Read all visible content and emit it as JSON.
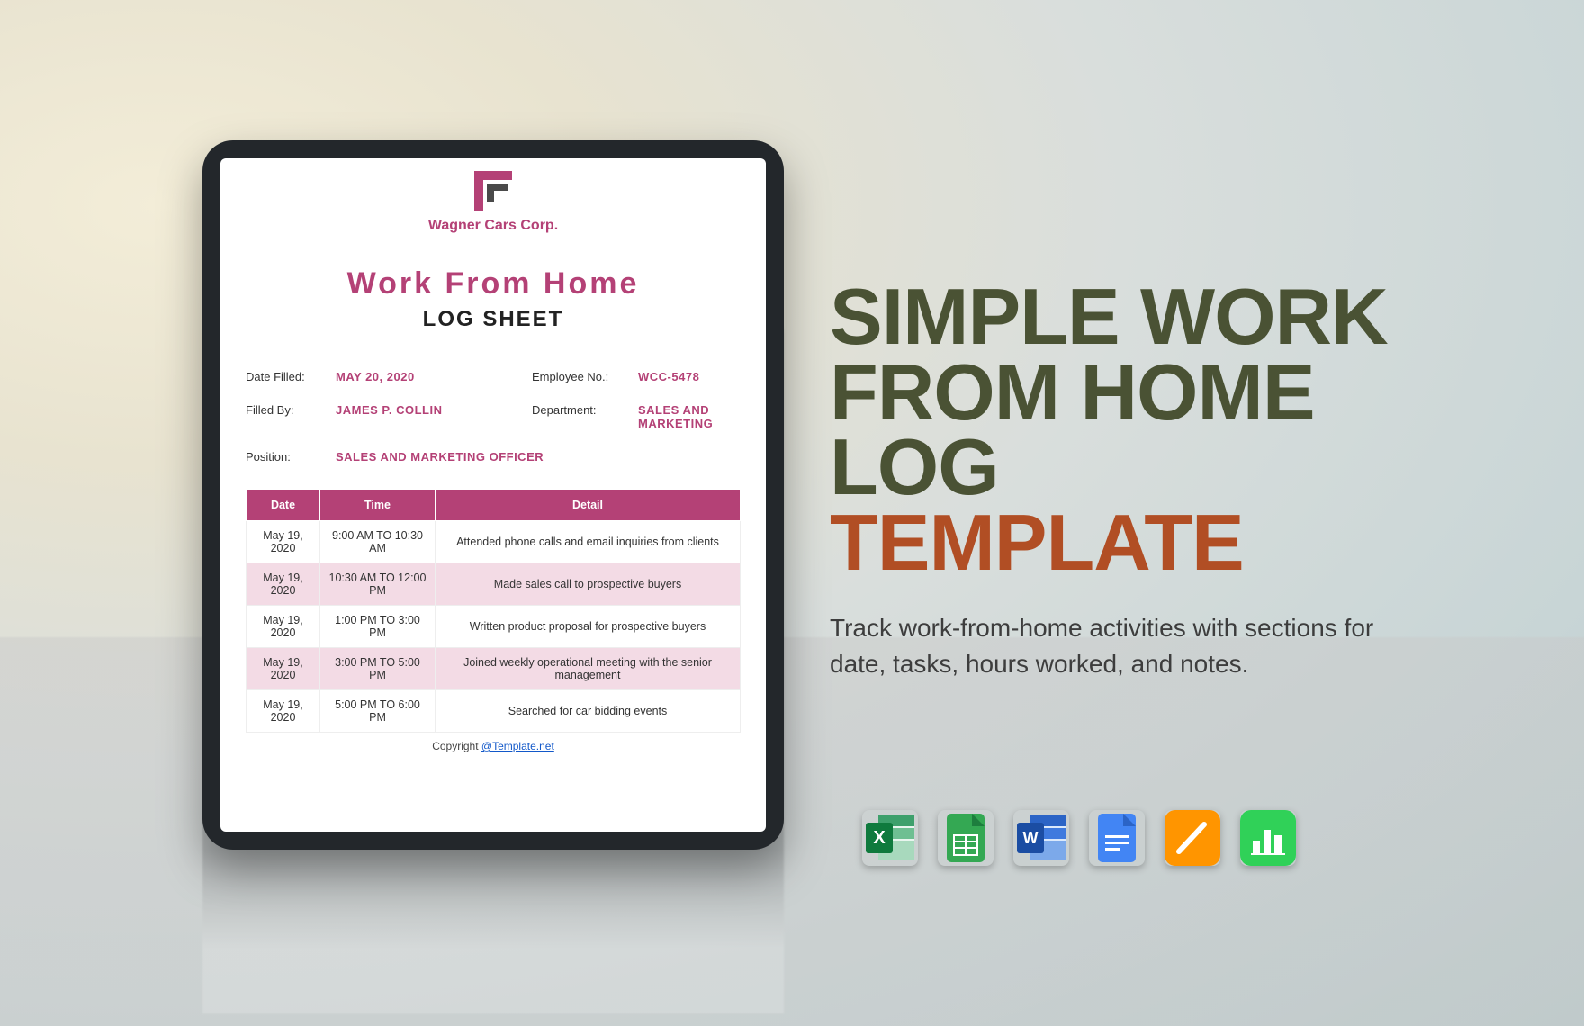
{
  "side": {
    "heading_main": "SIMPLE WORK FROM HOME LOG",
    "heading_accent": "TEMPLATE",
    "description": "Track work-from-home activities with sections for date, tasks, hours worked, and notes."
  },
  "apps": [
    {
      "name": "excel-icon"
    },
    {
      "name": "google-sheets-icon"
    },
    {
      "name": "word-icon"
    },
    {
      "name": "google-docs-icon"
    },
    {
      "name": "apple-pages-icon"
    },
    {
      "name": "apple-numbers-icon"
    }
  ],
  "doc": {
    "company": "Wagner Cars Corp.",
    "title_top": "Work From Home",
    "title_bottom": "LOG SHEET",
    "meta": {
      "date_filled_label": "Date Filled:",
      "date_filled": "MAY 20, 2020",
      "employee_no_label": "Employee No.:",
      "employee_no": "WCC-5478",
      "filled_by_label": "Filled By:",
      "filled_by": "JAMES P. COLLIN",
      "department_label": "Department:",
      "department": "SALES AND MARKETING",
      "position_label": "Position:",
      "position": "SALES AND MARKETING OFFICER"
    },
    "columns": [
      "Date",
      "Time",
      "Detail"
    ],
    "rows": [
      {
        "date": "May 19, 2020",
        "time": "9:00 AM TO 10:30 AM",
        "detail": "Attended phone calls and email inquiries from clients"
      },
      {
        "date": "May 19, 2020",
        "time": "10:30 AM TO 12:00 PM",
        "detail": "Made sales call to prospective buyers"
      },
      {
        "date": "May 19, 2020",
        "time": "1:00 PM TO 3:00 PM",
        "detail": "Written product proposal for prospective buyers"
      },
      {
        "date": "May 19, 2020",
        "time": "3:00 PM TO 5:00 PM",
        "detail": "Joined weekly operational meeting with the senior management"
      },
      {
        "date": "May 19, 2020",
        "time": "5:00 PM TO 6:00 PM",
        "detail": "Searched for car bidding events"
      }
    ],
    "copyright_prefix": "Copyright ",
    "copyright_link": "@Template.net"
  }
}
